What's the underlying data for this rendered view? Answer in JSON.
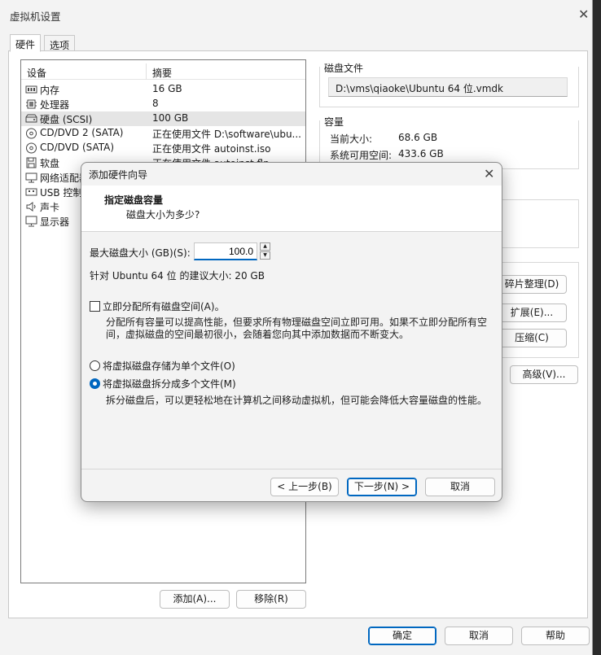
{
  "window": {
    "title": "虚拟机设置"
  },
  "tabs": [
    {
      "label": "硬件"
    },
    {
      "label": "选项"
    }
  ],
  "device_list": {
    "headers": {
      "device": "设备",
      "summary": "摘要"
    },
    "rows": [
      {
        "name": "内存",
        "summary": "16 GB",
        "icon": "memory-icon"
      },
      {
        "name": "处理器",
        "summary": "8",
        "icon": "processor-icon"
      },
      {
        "name": "硬盘 (SCSI)",
        "summary": "100 GB",
        "icon": "harddisk-icon",
        "selected": true
      },
      {
        "name": "CD/DVD 2 (SATA)",
        "summary": "正在使用文件 D:\\software\\ubu...",
        "icon": "cd-icon"
      },
      {
        "name": "CD/DVD (SATA)",
        "summary": "正在使用文件 autoinst.iso",
        "icon": "cd-icon"
      },
      {
        "name": "软盘",
        "summary": "正在使用文件 autoinst.flp",
        "icon": "floppy-icon"
      },
      {
        "name": "网络适配器",
        "summary": "",
        "icon": "network-icon"
      },
      {
        "name": "USB 控制器",
        "summary": "",
        "icon": "usb-icon"
      },
      {
        "name": "声卡",
        "summary": "",
        "icon": "sound-icon"
      },
      {
        "name": "显示器",
        "summary": "",
        "icon": "monitor-icon"
      }
    ],
    "add_button": "添加(A)...",
    "remove_button": "移除(R)"
  },
  "disk_file": {
    "title": "磁盘文件",
    "path": "D:\\vms\\qiaoke\\Ubuntu 64 位.vmdk"
  },
  "capacity": {
    "title": "容量",
    "current_size_label": "当前大小:",
    "current_size": "68.6 GB",
    "free_space_label": "系统可用空间:",
    "free_space": "433.6 GB"
  },
  "utilities": {
    "defrag_button": "碎片整理(D)",
    "expand_button": "扩展(E)...",
    "compact_button": "压缩(C)",
    "advanced_button": "高级(V)..."
  },
  "footer": {
    "ok_button": "确定",
    "cancel_button": "取消",
    "help_button": "帮助"
  },
  "wizard": {
    "title": "添加硬件向导",
    "heading": "指定磁盘容量",
    "subheading": "磁盘大小为多少?",
    "max_size_label": "最大磁盘大小 (GB)(S):",
    "max_size_value": "100.0",
    "recommended": "针对 Ubuntu 64 位 的建议大小: 20 GB",
    "allocate_label": "立即分配所有磁盘空间(A)。",
    "allocate_checked": false,
    "allocate_desc": "分配所有容量可以提高性能，但要求所有物理磁盘空间立即可用。如果不立即分配所有空间，虚拟磁盘的空间最初很小，会随着您向其中添加数据而不断变大。",
    "single_file_label": "将虚拟磁盘存储为单个文件(O)",
    "split_files_label": "将虚拟磁盘拆分成多个文件(M)",
    "selected_option": "split",
    "split_desc": "拆分磁盘后，可以更轻松地在计算机之间移动虚拟机，但可能会降低大容量磁盘的性能。",
    "back_button": "< 上一步(B)",
    "next_button": "下一步(N) >",
    "cancel_button": "取消"
  }
}
